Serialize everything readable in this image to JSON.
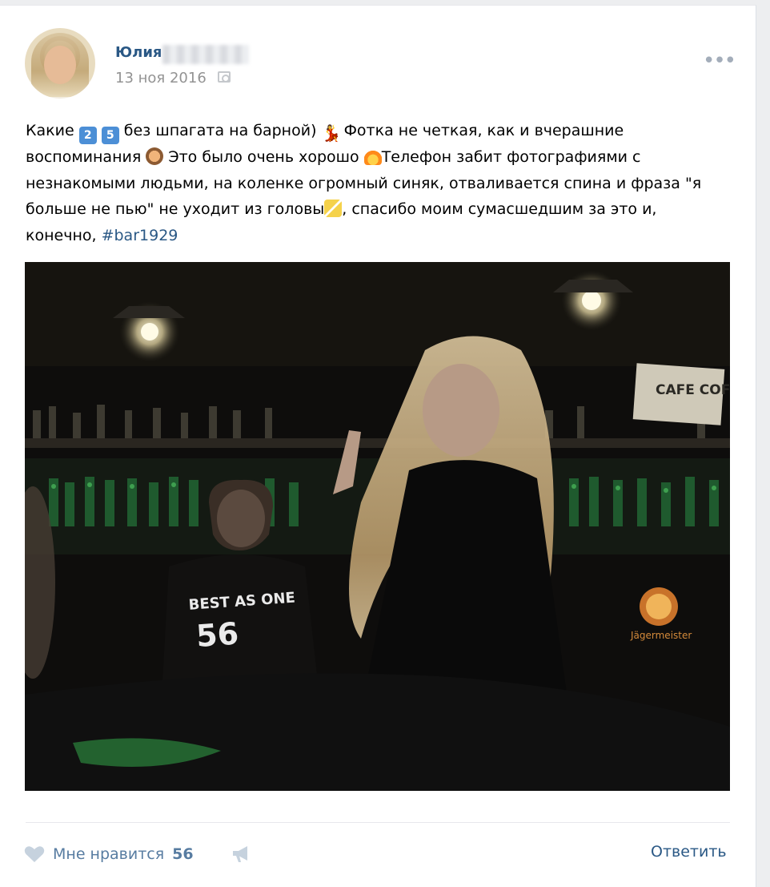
{
  "post": {
    "author_name": "Юлия",
    "date": "13 ноя 2016",
    "text": {
      "seg1": "Какие ",
      "digit1": "2",
      "digit2": "5",
      "seg2": " без шпагата на барной) ",
      "seg3": " Фотка не четкая, как и вчерашние воспоминания ",
      "seg4": " Это было очень хорошо ",
      "seg5": "Телефон забит фотографиями с незнакомыми людьми, на коленке огромный синяк, отваливается спина и фраза \"я больше не пью\" не уходит из головы",
      "seg6": ", спасибо моим сумасшедшим за это и, конечно, ",
      "hashtag": "#bar1929"
    },
    "photo": {
      "sign_text": "CAFE COFFEE",
      "shirt_text": "BEST AS ONE",
      "shirt_number": "56",
      "logo_text": "Jägermeister"
    }
  },
  "actions": {
    "like_label": "Мне нравится",
    "like_count": "56",
    "reply_label": "Ответить"
  },
  "icons": {
    "more": "more-dots-icon",
    "like": "heart-icon",
    "share": "megaphone-icon",
    "date": "camera-icon"
  },
  "colors": {
    "link": "#2a5885",
    "muted_link": "#577ca1",
    "date": "#939393",
    "background": "#edeef0"
  }
}
